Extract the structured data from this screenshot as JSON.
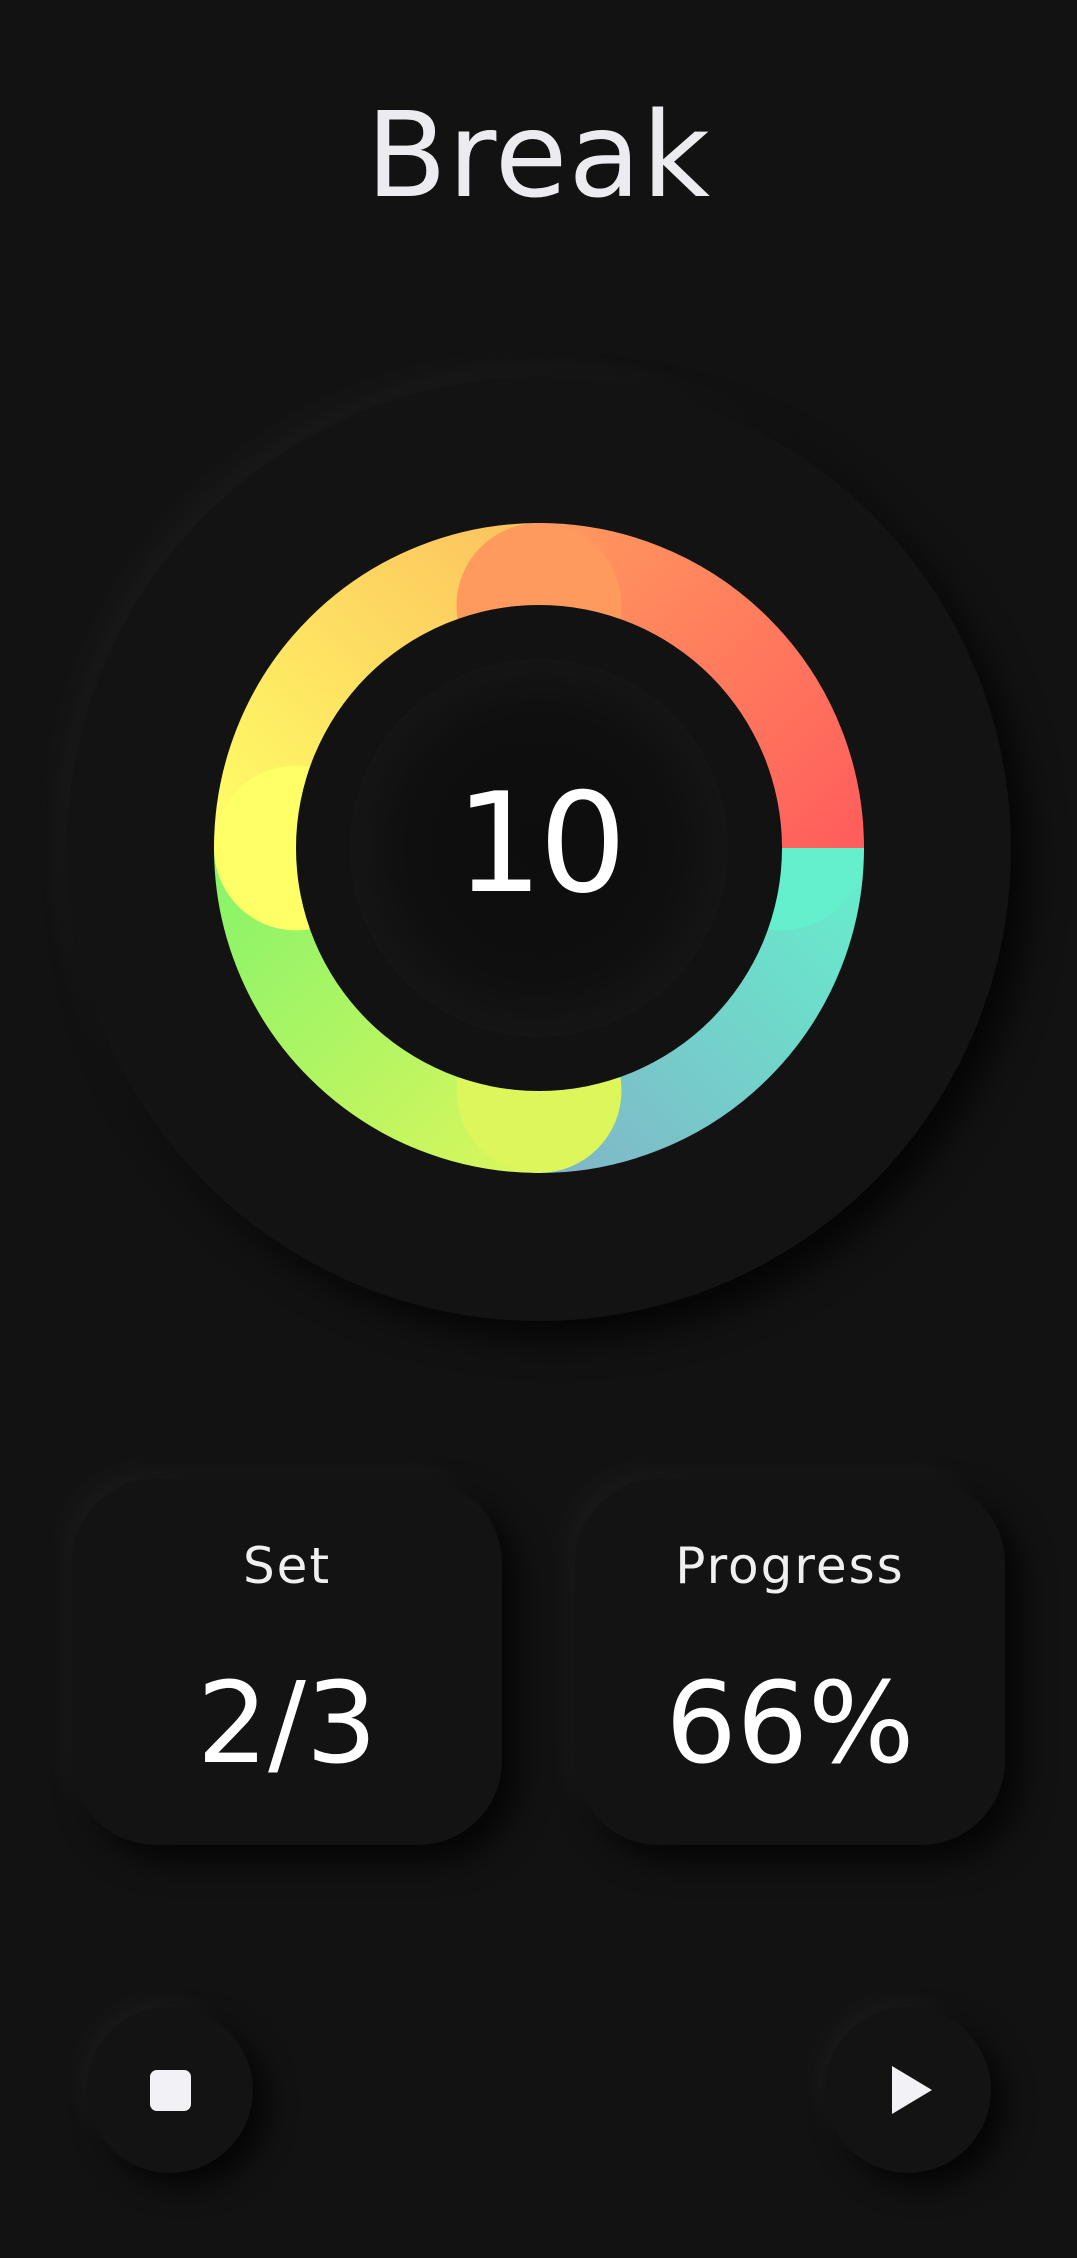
{
  "screen": {
    "title": "Break"
  },
  "timer": {
    "remaining": "10",
    "segments": [
      {
        "name": "segment-coral",
        "from": "#ff9a5e",
        "to": "#ff5c5c"
      },
      {
        "name": "segment-teal",
        "from": "#64f0cc",
        "to": "#82b4c8"
      },
      {
        "name": "segment-lime",
        "from": "#dcf65c",
        "to": "#84f46a"
      },
      {
        "name": "segment-yellow",
        "from": "#ffff66",
        "to": "#fcc05e"
      }
    ]
  },
  "stats": {
    "set_label": "Set",
    "set_value": "2/3",
    "progress_label": "Progress",
    "progress_value": "66%"
  },
  "controls": {
    "stop_icon": "stop-icon",
    "play_icon": "play-icon"
  },
  "colors": {
    "background": "#121212",
    "text": "#f2f2f4"
  }
}
